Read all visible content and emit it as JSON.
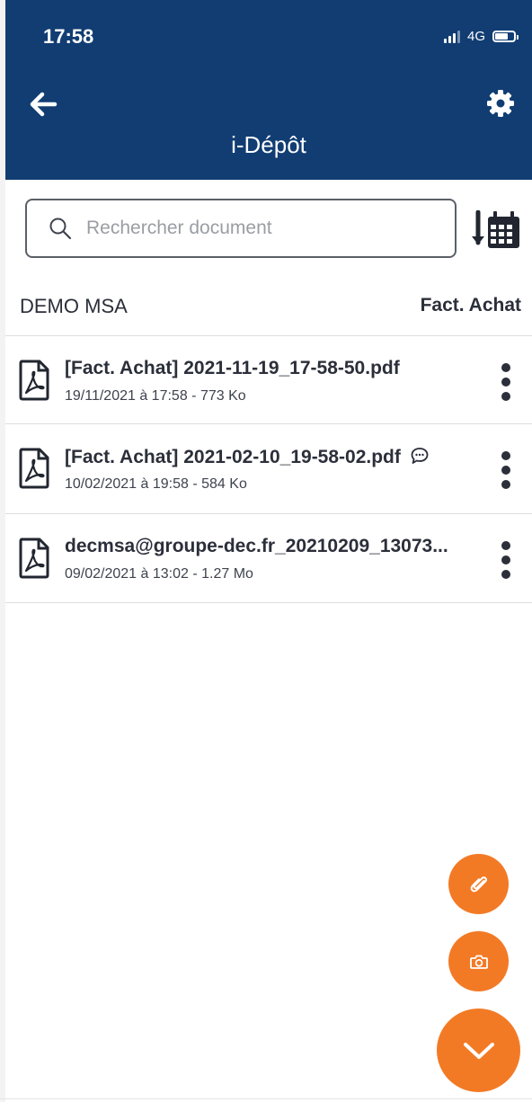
{
  "status_bar": {
    "time": "17:58",
    "network": "4G"
  },
  "header": {
    "title": "i-Dépôt"
  },
  "search": {
    "placeholder": "Rechercher document"
  },
  "list_header": {
    "account": "DEMO MSA",
    "category": "Fact. Achat"
  },
  "documents": [
    {
      "name": "[Fact. Achat] 2021-11-19_17-58-50.pdf",
      "meta": "19/11/2021 à 17:58 - 773 Ko",
      "has_comment": false
    },
    {
      "name": "[Fact. Achat] 2021-02-10_19-58-02.pdf",
      "meta": "10/02/2021 à 19:58 - 584 Ko",
      "has_comment": true
    },
    {
      "name": "decmsa@groupe-dec.fr_20210209_13073...",
      "meta": "09/02/2021 à 13:02 - 1.27 Mo",
      "has_comment": false
    }
  ],
  "icons": {
    "back": "arrow-left-icon",
    "settings": "gear-icon",
    "search": "search-icon",
    "sort": "sort-calendar-icon",
    "document": "pdf-file-icon",
    "comment": "comment-icon",
    "more": "more-vertical-icon",
    "attach": "paperclip-icon",
    "camera": "camera-icon",
    "toggle": "chevron-down-icon"
  },
  "colors": {
    "header_bg": "#113d73",
    "accent": "#f37a25",
    "text": "#2b2f3a"
  }
}
